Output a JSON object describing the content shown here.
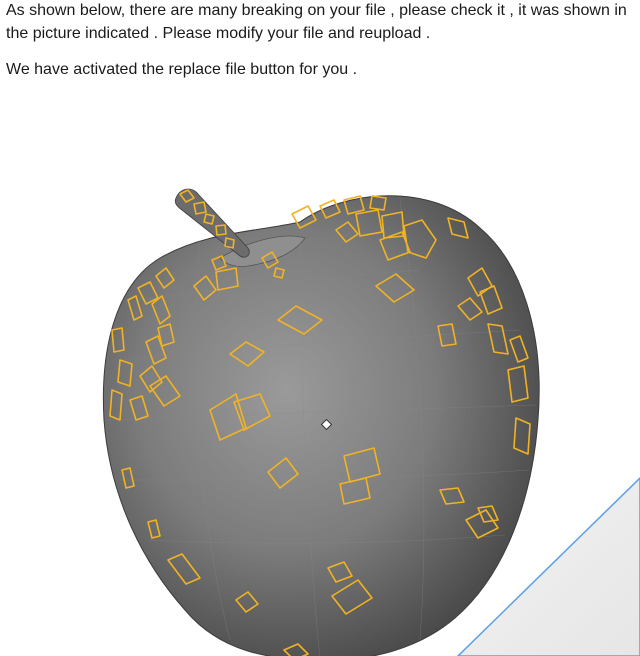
{
  "notice": {
    "line1": "As shown below, there are many breaking on your file , please check it , it was shown in the picture indicated . Please modify your file and reupload .",
    "line2": "We have activated the replace file button for you ."
  },
  "viewer": {
    "model": "apple-mesh",
    "highlight_color": "#f1b323",
    "background_color": "#ffffff",
    "floor_color": "#ececec",
    "floor_edge_color": "#5aa0e6"
  }
}
